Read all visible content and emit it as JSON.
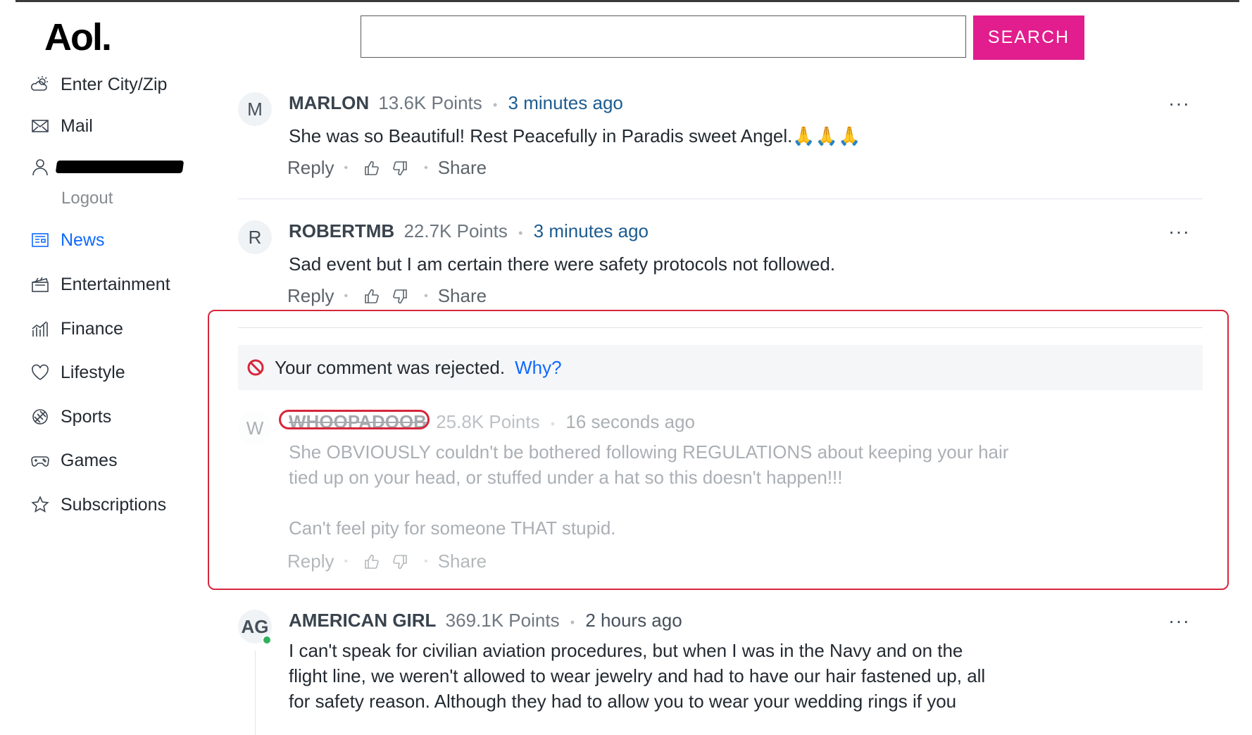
{
  "header": {
    "logo": "Aol.",
    "search_placeholder": "",
    "search_value": "",
    "search_button": "SEARCH",
    "accent_color": "#e21d8d"
  },
  "sidebar": {
    "items": [
      {
        "label": "Enter City/Zip",
        "icon": "weather-icon"
      },
      {
        "label": "Mail",
        "icon": "mail-icon"
      },
      {
        "label": "",
        "icon": "user-icon"
      },
      {
        "label": "News",
        "icon": "news-icon"
      },
      {
        "label": "Entertainment",
        "icon": "clapperboard-icon"
      },
      {
        "label": "Finance",
        "icon": "chart-icon"
      },
      {
        "label": "Lifestyle",
        "icon": "heart-icon"
      },
      {
        "label": "Sports",
        "icon": "ball-icon"
      },
      {
        "label": "Games",
        "icon": "gamepad-icon"
      },
      {
        "label": "Subscriptions",
        "icon": "star-icon"
      }
    ],
    "logout": "Logout",
    "active": "News"
  },
  "comments": [
    {
      "avatar": "M",
      "name": "MARLON",
      "points": "13.6K Points",
      "time": "3 minutes ago",
      "body": "She was so Beautiful! Rest Peacefully in Paradis sweet Angel.🙏🙏🙏",
      "reply": "Reply",
      "share": "Share",
      "more": "···"
    },
    {
      "avatar": "R",
      "name": "ROBERTMB",
      "points": "22.7K Points",
      "time": "3 minutes ago",
      "body": "Sad event but I am certain there were safety protocols not followed.",
      "reply": "Reply",
      "share": "Share",
      "more": "···"
    },
    {
      "avatar": "W",
      "name": "WHOOPADOOB",
      "points": "25.8K Points",
      "time": "16 seconds ago",
      "body_line1": "She OBVIOUSLY couldn't be bothered following REGULATIONS about keeping your hair",
      "body_line2": "tied up on your head, or stuffed under a hat so this doesn't happen!!!",
      "body_line3": "Can't feel pity for someone THAT stupid.",
      "reply": "Reply",
      "share": "Share"
    },
    {
      "avatar": "AG",
      "name": "AMERICAN GIRL",
      "points": "369.1K Points",
      "time": "2 hours ago",
      "body_line1": "I can't speak for civilian aviation procedures, but when I was in the Navy and on the",
      "body_line2": "flight line, we weren't allowed to wear jewelry and had to have our hair fastened up, all",
      "body_line3": "for safety reason. Although they had to allow you to wear your wedding rings if you",
      "more": "···"
    }
  ],
  "rejection": {
    "message": "Your comment was rejected.",
    "why": "Why?"
  }
}
